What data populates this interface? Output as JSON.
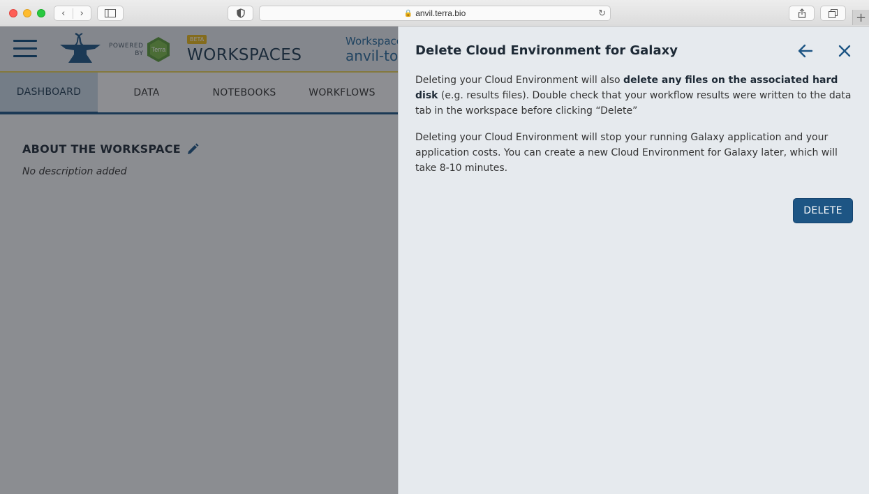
{
  "browser": {
    "url": "anvil.terra.bio",
    "nav_back": "‹",
    "nav_forward": "›",
    "plus": "+"
  },
  "app": {
    "powered_by_line1": "POWERED",
    "powered_by_line2": "BY",
    "terra_label": "Terra",
    "beta": "BETA",
    "title": "WORKSPACES",
    "workspace_label": "Workspace",
    "workspace_name": "anvil-to"
  },
  "tabs": [
    {
      "label": "DASHBOARD",
      "active": true
    },
    {
      "label": "DATA",
      "active": false
    },
    {
      "label": "NOTEBOOKS",
      "active": false
    },
    {
      "label": "WORKFLOWS",
      "active": false
    }
  ],
  "dashboard": {
    "about_title": "ABOUT THE WORKSPACE",
    "no_description": "No description added"
  },
  "drawer": {
    "title": "Delete Cloud Environment for Galaxy",
    "p1_pre": "Deleting your Cloud Environment will also ",
    "p1_bold": "delete any files on the associated hard disk",
    "p1_post": " (e.g. results files). Double check that your workflow results were written to the data tab in the workspace before clicking “Delete”",
    "p2": "Deleting your Cloud Environment will stop your running Galaxy application and your application costs. You can create a new Cloud Environment for Galaxy later, which will take 8-10 minutes.",
    "delete_label": "DELETE"
  },
  "colors": {
    "accent": "#1d5584",
    "drawer_bg": "#e6eaee"
  }
}
